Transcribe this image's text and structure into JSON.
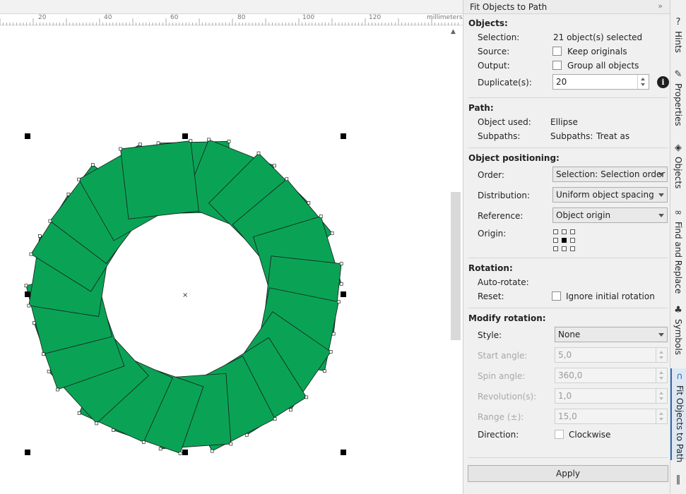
{
  "ruler": {
    "labels": [
      "20",
      "40",
      "60",
      "80",
      "100",
      "120"
    ],
    "unit": "millimeters"
  },
  "canvas": {
    "fill_color": "#0aa356",
    "stroke_color": "#1a1a1a",
    "ring_pieces": 21
  },
  "docker": {
    "title": "Fit Objects to Path",
    "header_icons": "»",
    "objects": {
      "title": "Objects:",
      "selection_label": "Selection:",
      "selection_value": "21 object(s) selected",
      "source_label": "Source:",
      "source_option": "Keep originals",
      "output_label": "Output:",
      "output_option": "Group all objects",
      "duplicates_label": "Duplicate(s):",
      "duplicates_value": "20",
      "info_glyph": "i"
    },
    "path": {
      "title": "Path:",
      "object_used_label": "Object used:",
      "object_used_value": "Ellipse",
      "subpaths_label": "Subpaths:",
      "subpaths_value": "Subpaths:",
      "subpaths_mode": "Treat as"
    },
    "positioning": {
      "title": "Object positioning:",
      "order_label": "Order:",
      "order_value": "Selection: Selection order",
      "distribution_label": "Distribution:",
      "distribution_value": "Uniform object spacing",
      "reference_label": "Reference:",
      "reference_value": "Object origin",
      "origin_label": "Origin:"
    },
    "rotation": {
      "title": "Rotation:",
      "auto_rotate_label": "Auto-rotate:",
      "reset_label": "Reset:",
      "reset_option": "Ignore initial rotation"
    },
    "modify_rotation": {
      "title": "Modify rotation:",
      "style_label": "Style:",
      "style_value": "None",
      "start_angle_label": "Start angle:",
      "start_angle_value": "5,0",
      "spin_angle_label": "Spin angle:",
      "spin_angle_value": "360,0",
      "revolutions_label": "Revolution(s):",
      "revolutions_value": "1,0",
      "range_label": "Range (±):",
      "range_value": "15,0",
      "direction_label": "Direction:",
      "direction_option": "Clockwise"
    },
    "apply_label": "Apply"
  },
  "tabs": [
    {
      "label": "Hints",
      "icon": "hints-icon",
      "glyph": "?"
    },
    {
      "label": "Properties",
      "icon": "properties-icon",
      "glyph": "✎"
    },
    {
      "label": "Objects",
      "icon": "objects-icon",
      "glyph": "◈"
    },
    {
      "label": "Find and Replace",
      "icon": "binoculars-icon",
      "glyph": "∞"
    },
    {
      "label": "Symbols",
      "icon": "symbols-icon",
      "glyph": "♣"
    },
    {
      "label": "Fit Objects to Path",
      "icon": "fit-path-icon",
      "glyph": "∩"
    },
    {
      "label": "",
      "icon": "align-icon",
      "glyph": "‖"
    }
  ]
}
